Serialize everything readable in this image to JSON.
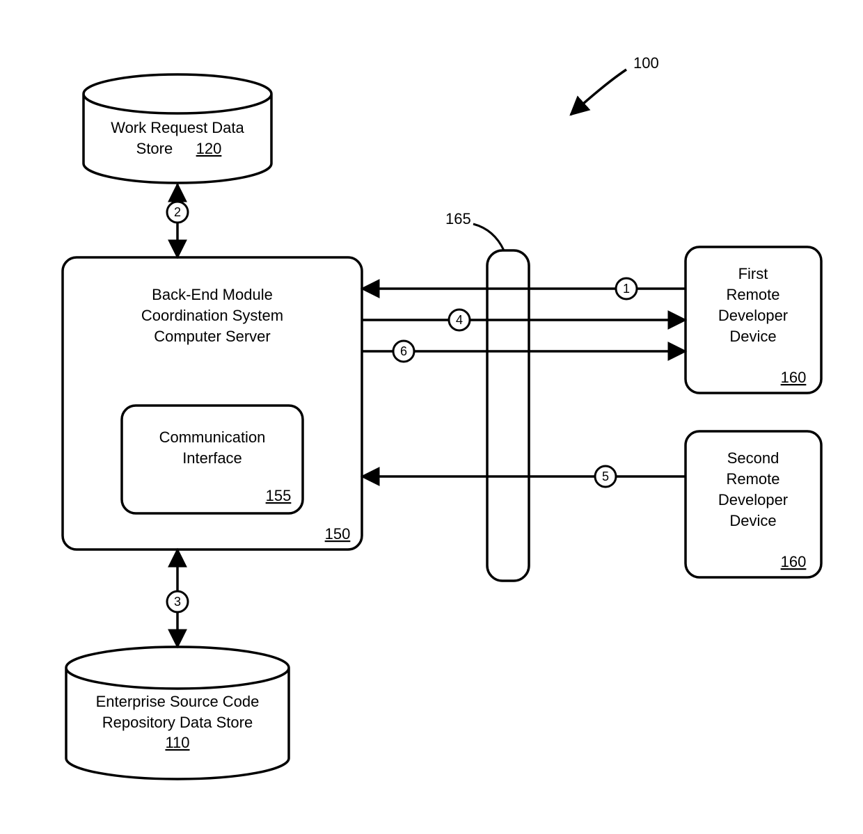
{
  "figure_ref": "100",
  "gateway_ref": "165",
  "work_request_store": {
    "line1": "Work Request Data",
    "line2": "Store",
    "ref": "120"
  },
  "repo_store": {
    "line1": "Enterprise Source Code",
    "line2": "Repository Data Store",
    "ref": "110"
  },
  "server": {
    "line1": "Back-End Module",
    "line2": "Coordination System",
    "line3": "Computer Server",
    "ref": "150"
  },
  "comm_if": {
    "line1": "Communication",
    "line2": "Interface",
    "ref": "155"
  },
  "dev1": {
    "line1": "First",
    "line2": "Remote",
    "line3": "Developer",
    "line4": "Device",
    "ref": "160"
  },
  "dev2": {
    "line1": "Second",
    "line2": "Remote",
    "line3": "Developer",
    "line4": "Device",
    "ref": "160"
  },
  "steps": {
    "s1": "1",
    "s2": "2",
    "s3": "3",
    "s4": "4",
    "s5": "5",
    "s6": "6"
  }
}
